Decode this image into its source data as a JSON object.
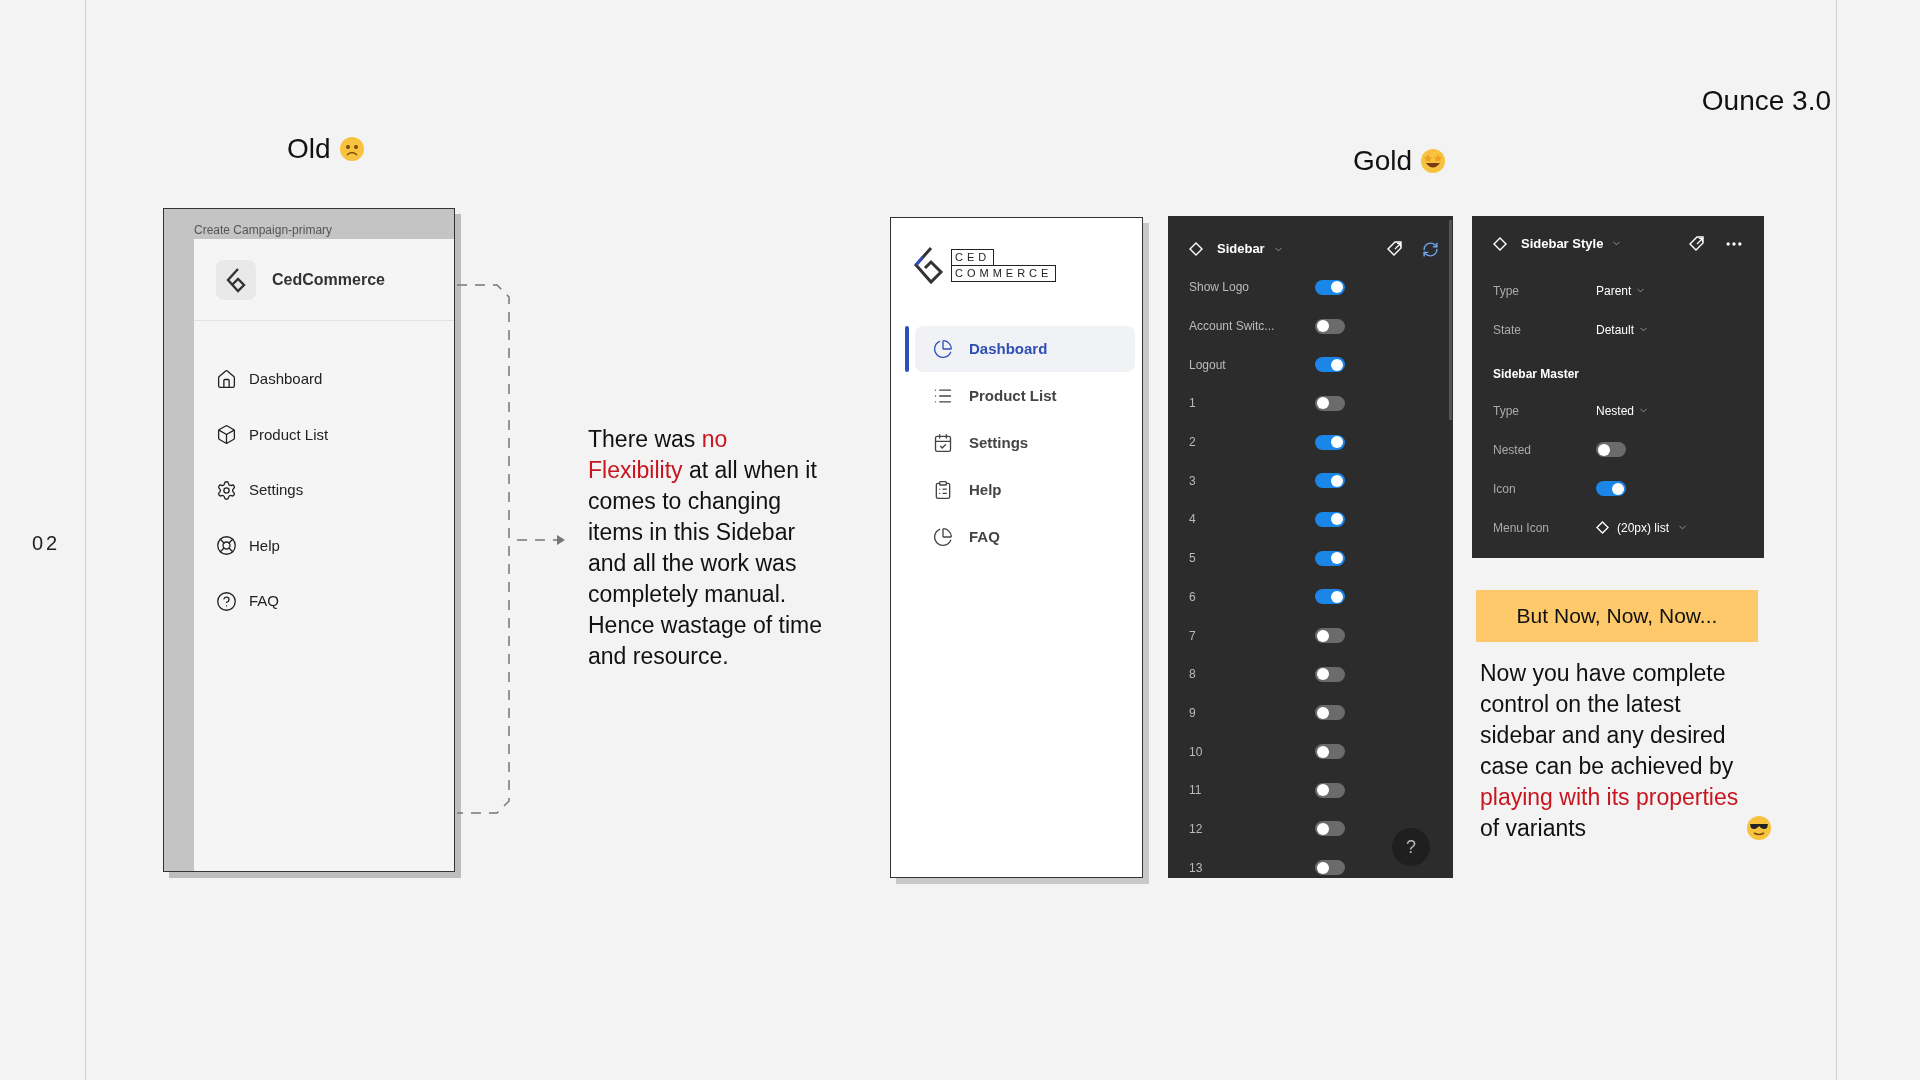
{
  "slide_number": "02",
  "product": "Ounce 3.0",
  "old": {
    "heading": "Old",
    "window_title": "Create Campaign-primary",
    "brand": "CedCommerce",
    "items": [
      {
        "label": "Dashboard"
      },
      {
        "label": "Product List"
      },
      {
        "label": "Settings"
      },
      {
        "label": "Help"
      },
      {
        "label": "FAQ"
      }
    ]
  },
  "old_note": [
    {
      "text": "There was ",
      "highlight": false
    },
    {
      "text": "no Flexibility",
      "highlight": true
    },
    {
      "text": " at all when it comes to changing items in this Sidebar and all the work was completely manual. Hence wastage of time and resource.",
      "highlight": false
    }
  ],
  "gold": {
    "heading": "Gold",
    "logo_top": "CED",
    "logo_bottom": "COMMERCE",
    "items": [
      {
        "label": "Dashboard",
        "selected": true
      },
      {
        "label": "Product List",
        "selected": false
      },
      {
        "label": "Settings",
        "selected": false
      },
      {
        "label": "Help",
        "selected": false
      },
      {
        "label": "FAQ",
        "selected": false
      }
    ]
  },
  "sidebar_panel": {
    "title": "Sidebar",
    "help": "?",
    "rows": [
      {
        "label": "Show Logo",
        "on": true
      },
      {
        "label": "Account Switc...",
        "on": false
      },
      {
        "label": "Logout",
        "on": true
      },
      {
        "label": "1",
        "on": false
      },
      {
        "label": "2",
        "on": true
      },
      {
        "label": "3",
        "on": true
      },
      {
        "label": "4",
        "on": true
      },
      {
        "label": "5",
        "on": true
      },
      {
        "label": "6",
        "on": true
      },
      {
        "label": "7",
        "on": false
      },
      {
        "label": "8",
        "on": false
      },
      {
        "label": "9",
        "on": false
      },
      {
        "label": "10",
        "on": false
      },
      {
        "label": "11",
        "on": false
      },
      {
        "label": "12",
        "on": false
      },
      {
        "label": "13",
        "on": false
      }
    ]
  },
  "style_panel": {
    "title": "Sidebar Style",
    "properties": [
      {
        "kind": "select",
        "label": "Type",
        "value": "Parent"
      },
      {
        "kind": "select",
        "label": "State",
        "value": "Detault"
      }
    ],
    "section": "Sidebar Master",
    "master_properties": [
      {
        "kind": "select",
        "label": "Type",
        "value": "Nested"
      },
      {
        "kind": "toggle",
        "label": "Nested",
        "on": false
      },
      {
        "kind": "toggle",
        "label": "Icon",
        "on": true
      },
      {
        "kind": "instance",
        "label": "Menu Icon",
        "value": "(20px) list"
      }
    ]
  },
  "banner": "But Now, Now, Now...",
  "new_note": [
    {
      "text": "Now you have complete control on the latest sidebar and any desired case can be achieved by ",
      "highlight": false
    },
    {
      "text": "playing with its properties",
      "highlight": true
    },
    {
      "text": " of variants",
      "highlight": false
    }
  ]
}
